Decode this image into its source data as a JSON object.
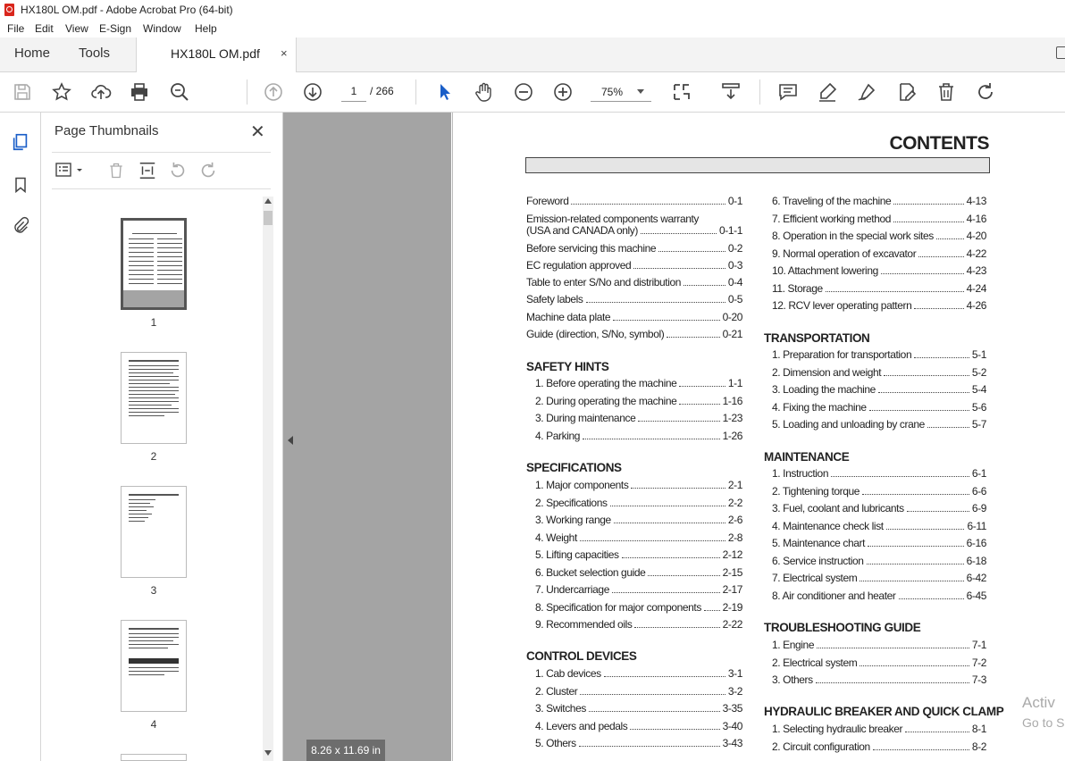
{
  "window": {
    "title": "HX180L OM.pdf - Adobe Acrobat Pro (64-bit)"
  },
  "menu": [
    "File",
    "Edit",
    "View",
    "E-Sign",
    "Window",
    "Help"
  ],
  "tabs": {
    "home": "Home",
    "tools": "Tools",
    "document": "HX180L OM.pdf",
    "close": "×"
  },
  "toolbar": {
    "page_current": "1",
    "page_total": "/  266",
    "zoom": "75%"
  },
  "panel": {
    "title": "Page Thumbnails",
    "close": "✕",
    "thumbnails": [
      {
        "num": "1"
      },
      {
        "num": "2"
      },
      {
        "num": "3"
      },
      {
        "num": "4"
      }
    ]
  },
  "page_size": "8.26 x 11.69 in",
  "document": {
    "title": "CONTENTS",
    "left_top": [
      {
        "label": "Foreword",
        "page": "0-1"
      },
      {
        "label": "Emission-related components warranty",
        "page": ""
      },
      {
        "label": "(USA and CANADA only)",
        "page": "0-1-1"
      },
      {
        "label": "Before servicing this machine",
        "page": "0-2"
      },
      {
        "label": "EC regulation approved",
        "page": "0-3"
      },
      {
        "label": "Table to enter S/No and distribution",
        "page": "0-4"
      },
      {
        "label": "Safety labels",
        "page": "0-5"
      },
      {
        "label": "Machine data plate",
        "page": "0-20"
      },
      {
        "label": "Guide (direction, S/No, symbol)",
        "page": "0-21"
      }
    ],
    "safety": {
      "heading": "SAFETY HINTS",
      "items": [
        {
          "label": "1. Before operating the machine",
          "page": "1-1"
        },
        {
          "label": "2. During operating the machine",
          "page": "1-16"
        },
        {
          "label": "3. During maintenance",
          "page": "1-23"
        },
        {
          "label": "4. Parking",
          "page": "1-26"
        }
      ]
    },
    "specs": {
      "heading": "SPECIFICATIONS",
      "items": [
        {
          "label": "1. Major components",
          "page": "2-1"
        },
        {
          "label": "2. Specifications",
          "page": "2-2"
        },
        {
          "label": "3. Working range",
          "page": "2-6"
        },
        {
          "label": "4. Weight",
          "page": "2-8"
        },
        {
          "label": "5. Lifting capacities",
          "page": "2-12"
        },
        {
          "label": "6. Bucket selection guide",
          "page": "2-15"
        },
        {
          "label": "7. Undercarriage",
          "page": "2-17"
        },
        {
          "label": "8. Specification for major components",
          "page": "2-19"
        },
        {
          "label": "9. Recommended oils",
          "page": "2-22"
        }
      ]
    },
    "control": {
      "heading": "CONTROL DEVICES",
      "items": [
        {
          "label": "1. Cab devices",
          "page": "3-1"
        },
        {
          "label": "2. Cluster",
          "page": "3-2"
        },
        {
          "label": "3. Switches",
          "page": "3-35"
        },
        {
          "label": "4. Levers and pedals",
          "page": "3-40"
        },
        {
          "label": "5. Others",
          "page": "3-43"
        }
      ]
    },
    "operation": {
      "items": [
        {
          "label": "6. Traveling of the machine",
          "page": "4-13"
        },
        {
          "label": "7. Efficient working method",
          "page": "4-16"
        },
        {
          "label": "8. Operation in the special work sites",
          "page": "4-20"
        },
        {
          "label": "9. Normal operation of excavator",
          "page": "4-22"
        },
        {
          "label": "10. Attachment lowering",
          "page": "4-23"
        },
        {
          "label": "11. Storage",
          "page": "4-24"
        },
        {
          "label": "12. RCV lever operating pattern",
          "page": "4-26"
        }
      ]
    },
    "transport": {
      "heading": "TRANSPORTATION",
      "items": [
        {
          "label": "1. Preparation for transportation",
          "page": "5-1"
        },
        {
          "label": "2. Dimension and weight",
          "page": "5-2"
        },
        {
          "label": "3. Loading the machine",
          "page": "5-4"
        },
        {
          "label": "4. Fixing the machine",
          "page": "5-6"
        },
        {
          "label": "5. Loading and unloading by crane",
          "page": "5-7"
        }
      ]
    },
    "maintenance": {
      "heading": "MAINTENANCE",
      "items": [
        {
          "label": "1. Instruction",
          "page": "6-1"
        },
        {
          "label": "2. Tightening torque",
          "page": "6-6"
        },
        {
          "label": "3. Fuel, coolant and lubricants",
          "page": "6-9"
        },
        {
          "label": "4. Maintenance check list",
          "page": "6-11"
        },
        {
          "label": "5. Maintenance chart",
          "page": "6-16"
        },
        {
          "label": "6. Service instruction",
          "page": "6-18"
        },
        {
          "label": "7. Electrical system",
          "page": "6-42"
        },
        {
          "label": "8. Air conditioner and heater",
          "page": "6-45"
        }
      ]
    },
    "trouble": {
      "heading": "TROUBLESHOOTING GUIDE",
      "items": [
        {
          "label": "1. Engine",
          "page": "7-1"
        },
        {
          "label": "2. Electrical system",
          "page": "7-2"
        },
        {
          "label": "3. Others",
          "page": "7-3"
        }
      ]
    },
    "breaker": {
      "heading": "HYDRAULIC BREAKER AND QUICK CLAMP",
      "items": [
        {
          "label": "1. Selecting hydraulic breaker",
          "page": "8-1"
        },
        {
          "label": "2. Circuit configuration",
          "page": "8-2"
        }
      ]
    }
  },
  "watermark": {
    "line1": "Activ",
    "line2": "Go to S"
  }
}
